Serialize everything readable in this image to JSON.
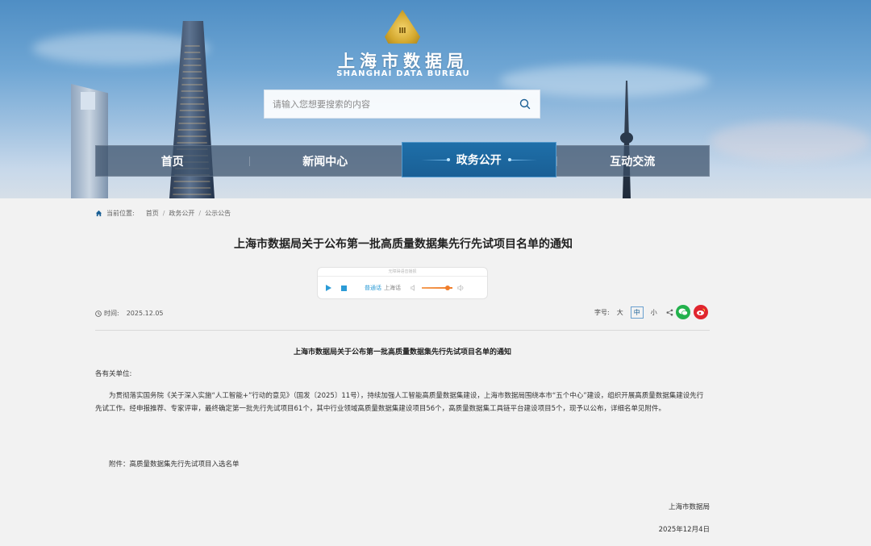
{
  "header": {
    "logo_cn": "上海市数据局",
    "logo_en": "SHANGHAI DATA BUREAU",
    "emblem_text": "Ⅲ"
  },
  "search": {
    "placeholder": "请输入您想要搜索的内容",
    "value": ""
  },
  "nav": {
    "items": [
      {
        "label": "首页"
      },
      {
        "label": "新闻中心"
      },
      {
        "label": "政务公开"
      },
      {
        "label": "互动交流"
      }
    ],
    "active_index": 2
  },
  "breadcrumb": {
    "prefix": "当前位置:",
    "items": [
      "首页",
      "政务公开",
      "公示公告"
    ]
  },
  "article": {
    "title": "上海市数据局关于公布第一批高质量数据集先行先试项目名单的通知",
    "time_label": "时间:",
    "date": "2025.12.05",
    "doc_title": "上海市数据局关于公布第一批高质量数据集先行先试项目名单的通知",
    "salutation": "各有关单位:",
    "body": "为贯彻落实国务院《关于深入实施“人工智能+”行动的意见》（国发〔2025〕11号），持续加强人工智能高质量数据集建设，上海市数据局围绕本市“五个中心”建设，组织开展高质量数据集建设先行先试工作。经申报推荐、专家评审，最终确定第一批先行先试项目61个，其中行业领域高质量数据集建设项目56个，高质量数据集工具链平台建设项目5个，现予以公布，详细名单见附件。",
    "attachment": "附件：高质量数据集先行先试项目入选名单",
    "sign_org": "上海市数据局",
    "sign_date": "2025年12月4日"
  },
  "player": {
    "header": "无障碍语音播报",
    "voice": "普通话",
    "voice_name": "上海话",
    "volume": 0.85
  },
  "font_size": {
    "label": "字号:",
    "options": [
      "大",
      "中",
      "小"
    ],
    "active_index": 1
  },
  "colors": {
    "nav_active": "#1a5f95",
    "wechat": "#22b14c",
    "weibo": "#e0252e",
    "volume": "#f07d2a"
  }
}
